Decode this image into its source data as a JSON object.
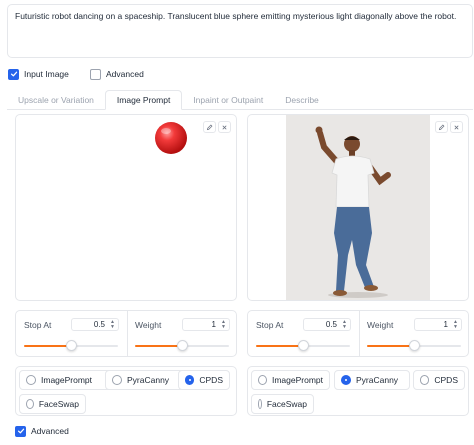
{
  "prompt": {
    "text": "Futuristic robot dancing on a spaceship. Translucent blue sphere emitting mysterious light diagonally above the robot."
  },
  "options": {
    "input_image": {
      "label": "Input Image",
      "checked": true
    },
    "advanced": {
      "label": "Advanced",
      "checked": false
    }
  },
  "tabs": [
    {
      "label": "Upscale or Variation",
      "active": false
    },
    {
      "label": "Image Prompt",
      "active": true
    },
    {
      "label": "Inpaint or Outpaint",
      "active": false
    },
    {
      "label": "Describe",
      "active": false
    }
  ],
  "slots": [
    {
      "image": "red-sphere",
      "stop_at": {
        "label": "Stop At",
        "value": "0.5",
        "fraction": 0.5
      },
      "weight": {
        "label": "Weight",
        "value": "1",
        "fraction": 0.5
      },
      "types": [
        {
          "label": "ImagePrompt",
          "selected": false
        },
        {
          "label": "PyraCanny",
          "selected": false
        },
        {
          "label": "CPDS",
          "selected": true
        },
        {
          "label": "FaceSwap",
          "selected": false
        }
      ]
    },
    {
      "image": "dancing-man-photo",
      "stop_at": {
        "label": "Stop At",
        "value": "0.5",
        "fraction": 0.5
      },
      "weight": {
        "label": "Weight",
        "value": "1",
        "fraction": 0.5
      },
      "types": [
        {
          "label": "ImagePrompt",
          "selected": false
        },
        {
          "label": "PyraCanny",
          "selected": true
        },
        {
          "label": "CPDS",
          "selected": false
        },
        {
          "label": "FaceSwap",
          "selected": false
        }
      ]
    }
  ],
  "advanced_bottom": {
    "label": "Advanced",
    "checked": true
  },
  "colors": {
    "accent": "#2563eb",
    "slider": "#f97316",
    "sphere": "#e11d1d"
  }
}
